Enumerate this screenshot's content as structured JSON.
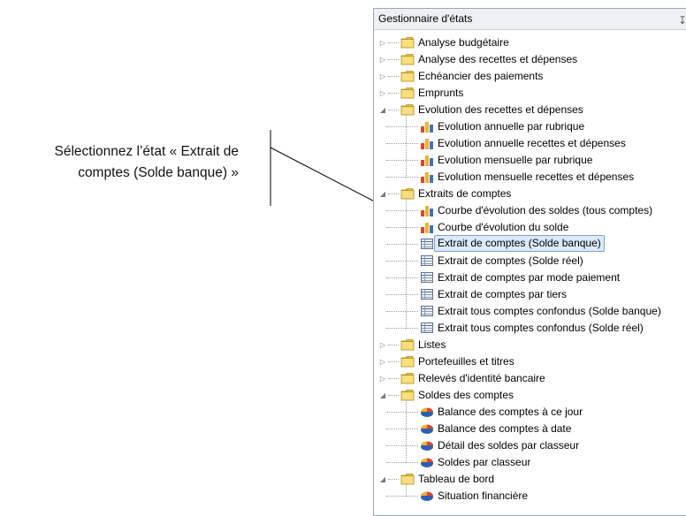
{
  "callout": {
    "line1": "Sélectionnez l’état « Extrait de",
    "line2": "comptes (Solde banque) »"
  },
  "panel": {
    "title": "Gestionnaire d'états",
    "pin_icon": "pin-icon"
  },
  "tree": [
    {
      "label": "Analyse budgétaire",
      "level": 0,
      "icon": "folder-icon",
      "expander": "collapsed"
    },
    {
      "label": "Analyse des recettes et dépenses",
      "level": 0,
      "icon": "folder-icon",
      "expander": "collapsed"
    },
    {
      "label": "Echéancier des paiements",
      "level": 0,
      "icon": "folder-icon",
      "expander": "collapsed"
    },
    {
      "label": "Emprunts",
      "level": 0,
      "icon": "folder-icon",
      "expander": "collapsed"
    },
    {
      "label": "Evolution des recettes et dépenses",
      "level": 0,
      "icon": "folder-icon",
      "expander": "expanded"
    },
    {
      "label": "Evolution annuelle par rubrique",
      "level": 1,
      "icon": "bar-chart-icon"
    },
    {
      "label": "Evolution annuelle recettes et dépenses",
      "level": 1,
      "icon": "bar-chart-icon"
    },
    {
      "label": "Evolution mensuelle par rubrique",
      "level": 1,
      "icon": "bar-chart-icon"
    },
    {
      "label": "Evolution mensuelle recettes et dépenses",
      "level": 1,
      "icon": "bar-chart-icon"
    },
    {
      "label": "Extraits de comptes",
      "level": 0,
      "icon": "folder-icon",
      "expander": "expanded"
    },
    {
      "label": "Courbe d'évolution des soldes (tous comptes)",
      "level": 1,
      "icon": "bar-chart-icon"
    },
    {
      "label": "Courbe d'évolution du solde",
      "level": 1,
      "icon": "bar-chart-icon"
    },
    {
      "label": "Extrait de comptes (Solde banque)",
      "level": 1,
      "icon": "table-icon",
      "selected": true
    },
    {
      "label": "Extrait de comptes (Solde réel)",
      "level": 1,
      "icon": "table-icon"
    },
    {
      "label": "Extrait de comptes par mode paiement",
      "level": 1,
      "icon": "table-icon"
    },
    {
      "label": "Extrait de comptes par tiers",
      "level": 1,
      "icon": "table-icon"
    },
    {
      "label": "Extrait tous comptes confondus (Solde banque)",
      "level": 1,
      "icon": "table-icon"
    },
    {
      "label": "Extrait tous comptes confondus (Solde réel)",
      "level": 1,
      "icon": "table-icon"
    },
    {
      "label": "Listes",
      "level": 0,
      "icon": "folder-icon",
      "expander": "collapsed"
    },
    {
      "label": "Portefeuilles et titres",
      "level": 0,
      "icon": "folder-icon",
      "expander": "collapsed"
    },
    {
      "label": "Relevés d'identité bancaire",
      "level": 0,
      "icon": "folder-icon",
      "expander": "collapsed"
    },
    {
      "label": "Soldes des comptes",
      "level": 0,
      "icon": "folder-icon",
      "expander": "expanded"
    },
    {
      "label": "Balance des comptes à ce jour",
      "level": 1,
      "icon": "pie-chart-icon"
    },
    {
      "label": "Balance des comptes à date",
      "level": 1,
      "icon": "pie-chart-icon"
    },
    {
      "label": "Détail des soldes par classeur",
      "level": 1,
      "icon": "pie-chart-icon"
    },
    {
      "label": "Soldes par classeur",
      "level": 1,
      "icon": "pie-chart-icon"
    },
    {
      "label": "Tableau de bord",
      "level": 0,
      "icon": "folder-icon",
      "expander": "expanded"
    },
    {
      "label": "Situation financière",
      "level": 1,
      "icon": "pie-chart-icon"
    }
  ]
}
